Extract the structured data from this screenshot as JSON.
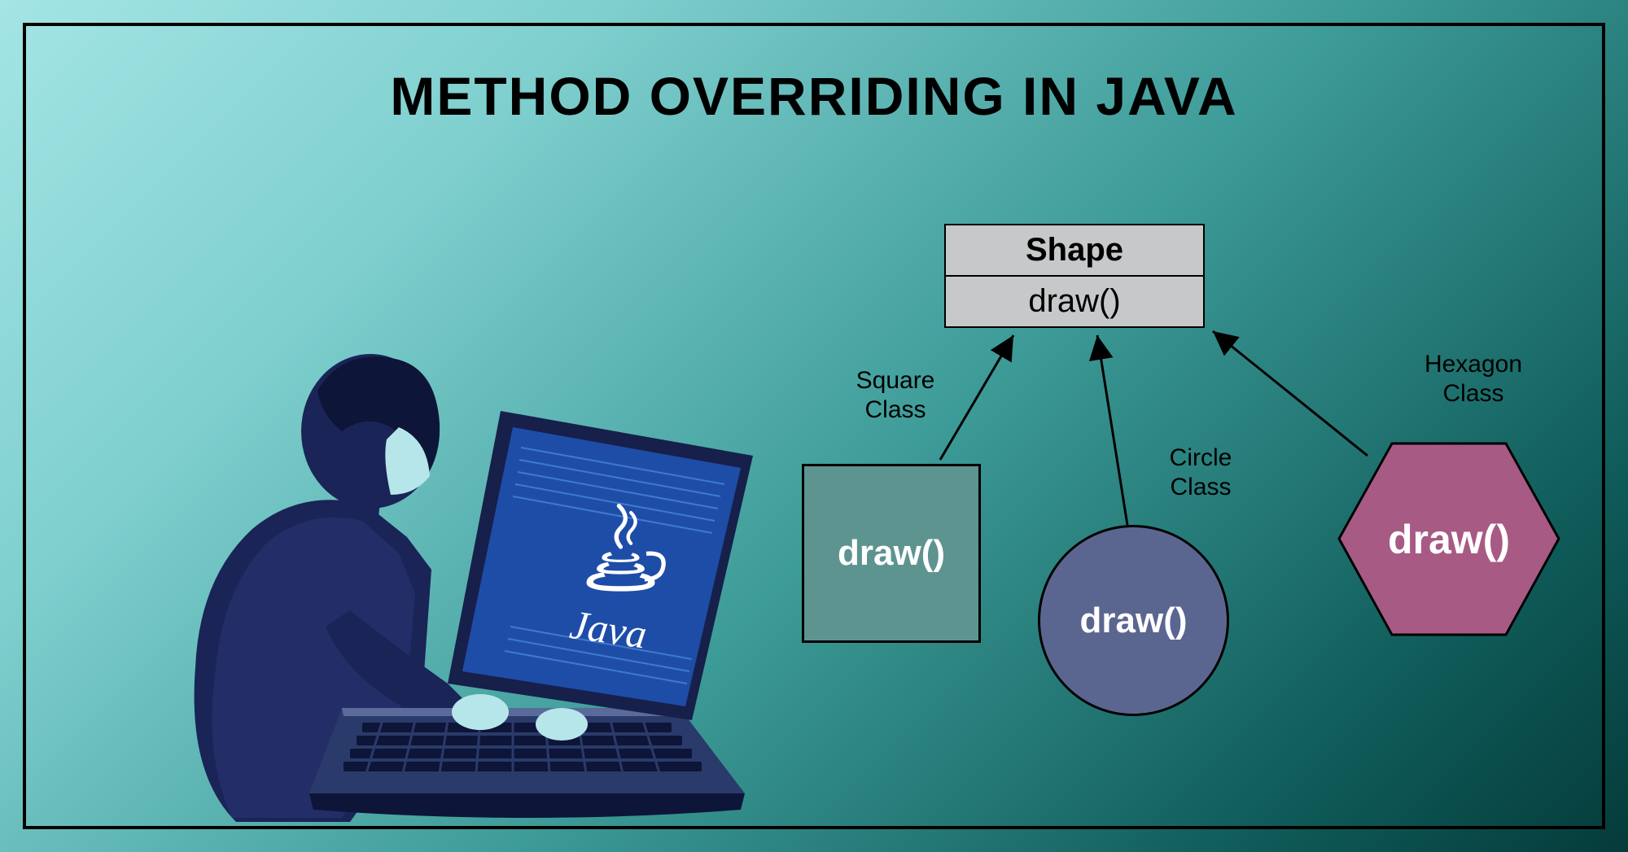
{
  "title": "METHOD OVERRIDING IN JAVA",
  "laptop_label": "Java",
  "uml": {
    "class_name": "Shape",
    "method": "draw()"
  },
  "subclasses": {
    "square": {
      "label_line1": "Square",
      "label_line2": "Class",
      "method": "draw()"
    },
    "circle": {
      "label_line1": "Circle",
      "label_line2": "Class",
      "method": "draw()"
    },
    "hexagon": {
      "label_line1": "Hexagon",
      "label_line2": "Class",
      "method": "draw()"
    }
  }
}
